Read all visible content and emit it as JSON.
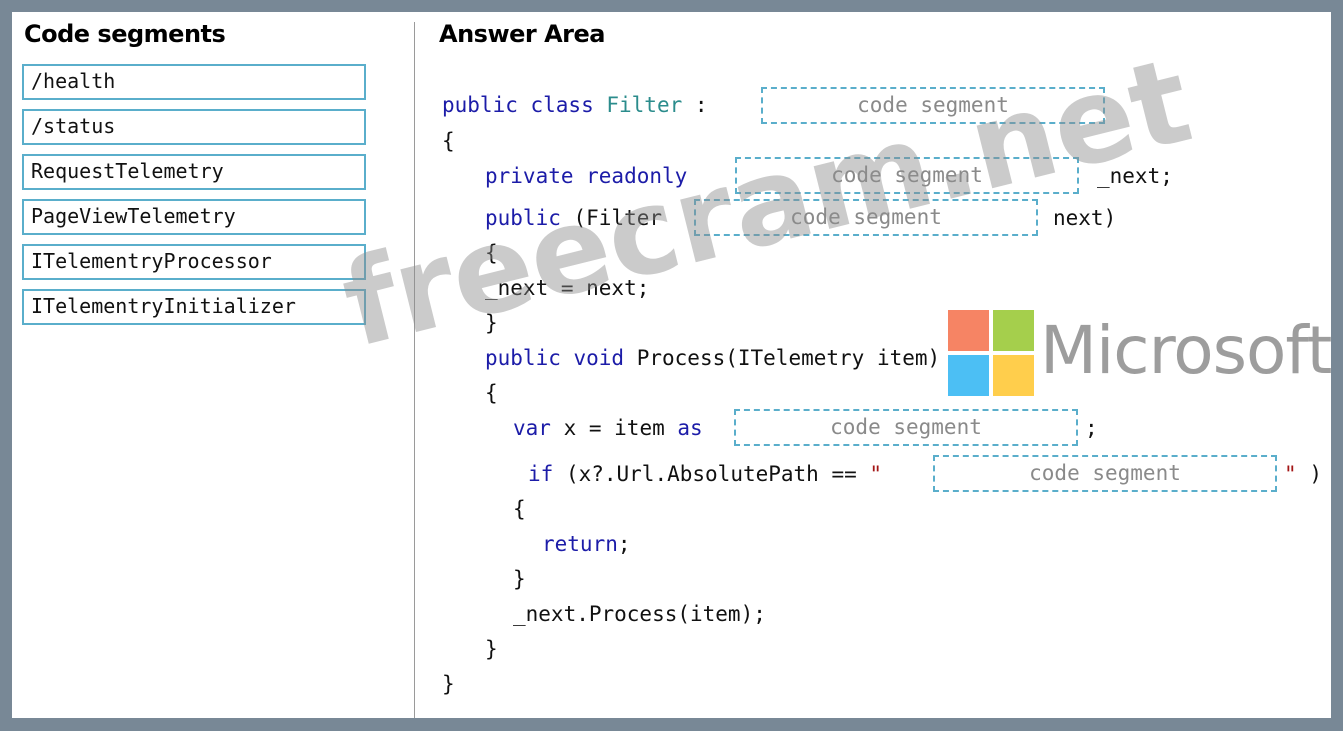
{
  "left_panel": {
    "title": "Code segments",
    "segments": [
      "/health",
      "/status",
      "RequestTelemetry",
      "PageViewTelemetry",
      "ITelementryProcessor",
      "ITelementryInitializer"
    ]
  },
  "answer_area": {
    "title": "Answer Area",
    "drop_placeholder": "code segment",
    "lines": {
      "l1_kw": "public class",
      "l1_type": "Filter",
      "l1_colon": ":",
      "l2": "{",
      "l3_kw": "private readonly",
      "l3_after": "_next;",
      "l4_kw": "public",
      "l4_text": "(Filter",
      "l4_after": "next)",
      "l5": "{",
      "l6": "_next = next;",
      "l7": "}",
      "l8_kw": "public void",
      "l8_text": "Process(ITelemetry item)",
      "l9": "{",
      "l10_kw1": "var",
      "l10_text": "x = item",
      "l10_kw2": "as",
      "l10_after": ";",
      "l11_kw": "if",
      "l11_text": "(x?.Url.AbsolutePath ==",
      "l11_quote_open": "\"",
      "l11_quote_close": "\"",
      "l11_after": ")",
      "l12": "{",
      "l13_kw": "return",
      "l13_after": ";",
      "l14": "}",
      "l15": "_next.Process(item);",
      "l16": "}",
      "l17": "}"
    }
  },
  "watermarks": {
    "site": "freecram.net",
    "brand": "Microsoft",
    "logo_colors": [
      "#f25022",
      "#7fba00",
      "#00a4ef",
      "#ffb900"
    ]
  }
}
